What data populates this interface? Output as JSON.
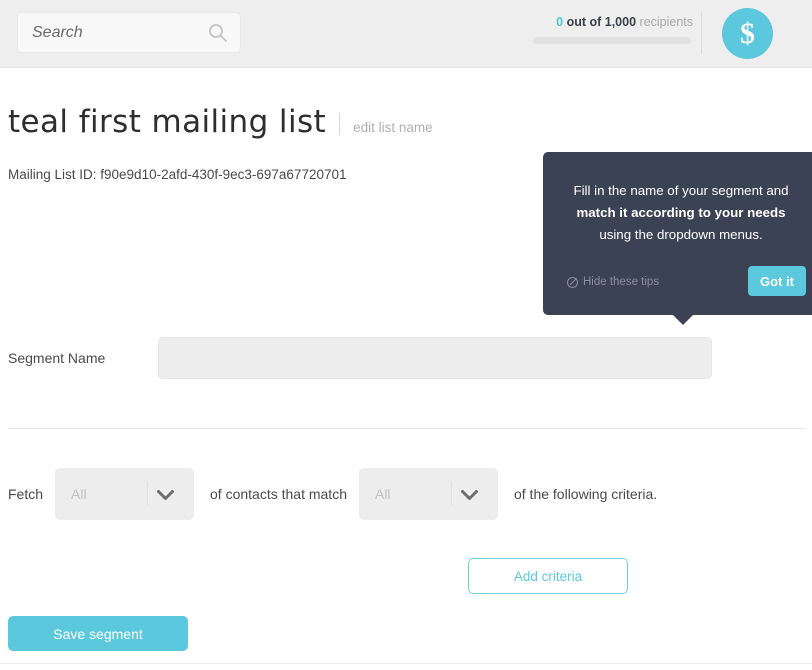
{
  "header": {
    "search": {
      "placeholder": "Search",
      "value": "",
      "icon": "search-icon"
    },
    "recipients": {
      "count": "0",
      "middle": " out of 1,000 ",
      "label": "recipients",
      "progress_percent": 0
    },
    "avatar": {
      "glyph": "$",
      "color": "#5bc8dd"
    }
  },
  "page": {
    "title": "teal first mailing list",
    "edit_link": "edit list name",
    "mailing_list_id": "Mailing List ID: f90e9d10-2afd-430f-9ec3-697a67720701"
  },
  "tooltip": {
    "text_part1": "Fill in the name of your segment and ",
    "text_bold": "match it according to your needs",
    "text_part2": " using the dropdown menus.",
    "hide_label": "Hide these tips",
    "hide_icon": "circle-slash-icon",
    "got_it_label": "Got it",
    "background": "#3b4254",
    "accent": "#5bc8dd"
  },
  "form": {
    "segment_name_label": "Segment Name",
    "segment_name_value": "",
    "segment_name_placeholder": "",
    "fetch_label": "Fetch",
    "fetch_dropdown_value": "All",
    "middle_text": "of contacts that match",
    "match_dropdown_value": "All",
    "tail_text": "of the following criteria.",
    "chevron_icon": "chevron-down-icon"
  },
  "actions": {
    "add_criteria_label": "Add criteria",
    "save_segment_label": "Save segment"
  }
}
